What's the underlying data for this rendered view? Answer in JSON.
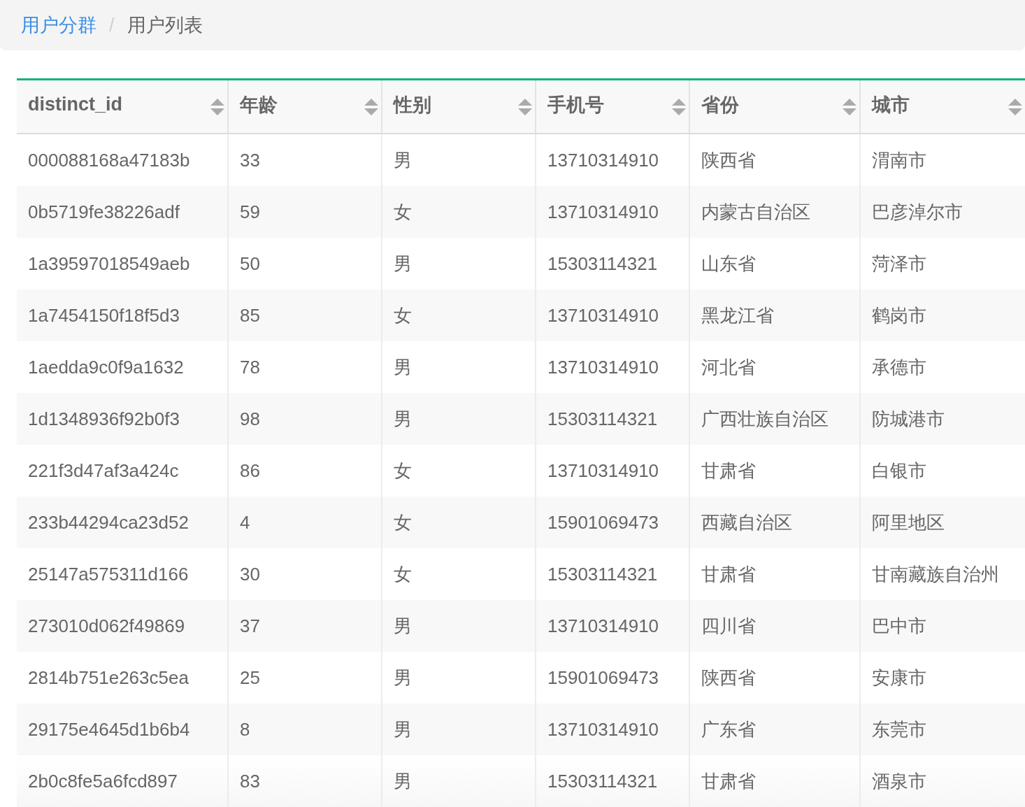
{
  "breadcrumb": [
    {
      "label": "用户分群",
      "kind": "link"
    },
    {
      "label": "/",
      "kind": "separator"
    },
    {
      "label": "用户列表",
      "kind": "current"
    }
  ],
  "table": {
    "columns": [
      "distinct_id",
      "年龄",
      "性别",
      "手机号",
      "省份",
      "城市"
    ],
    "rows": [
      [
        "000088168a47183b",
        "33",
        "男",
        "13710314910",
        "陕西省",
        "渭南市"
      ],
      [
        "0b5719fe38226adf",
        "59",
        "女",
        "13710314910",
        "内蒙古自治区",
        "巴彦淖尔市"
      ],
      [
        "1a39597018549aeb",
        "50",
        "男",
        "15303114321",
        "山东省",
        "菏泽市"
      ],
      [
        "1a7454150f18f5d3",
        "85",
        "女",
        "13710314910",
        "黑龙江省",
        "鹤岗市"
      ],
      [
        "1aedda9c0f9a1632",
        "78",
        "男",
        "13710314910",
        "河北省",
        "承德市"
      ],
      [
        "1d1348936f92b0f3",
        "98",
        "男",
        "15303114321",
        "广西壮族自治区",
        "防城港市"
      ],
      [
        "221f3d47af3a424c",
        "86",
        "女",
        "13710314910",
        "甘肃省",
        "白银市"
      ],
      [
        "233b44294ca23d52",
        "4",
        "女",
        "15901069473",
        "西藏自治区",
        "阿里地区"
      ],
      [
        "25147a575311d166",
        "30",
        "女",
        "15303114321",
        "甘肃省",
        "甘南藏族自治州"
      ],
      [
        "273010d062f49869",
        "37",
        "男",
        "13710314910",
        "四川省",
        "巴中市"
      ],
      [
        "2814b751e263c5ea",
        "25",
        "男",
        "15901069473",
        "陕西省",
        "安康市"
      ],
      [
        "29175e4645d1b6b4",
        "8",
        "男",
        "13710314910",
        "广东省",
        "东莞市"
      ],
      [
        "2b0c8fe5a6fcd897",
        "83",
        "男",
        "15303114321",
        "甘肃省",
        "酒泉市"
      ]
    ]
  }
}
